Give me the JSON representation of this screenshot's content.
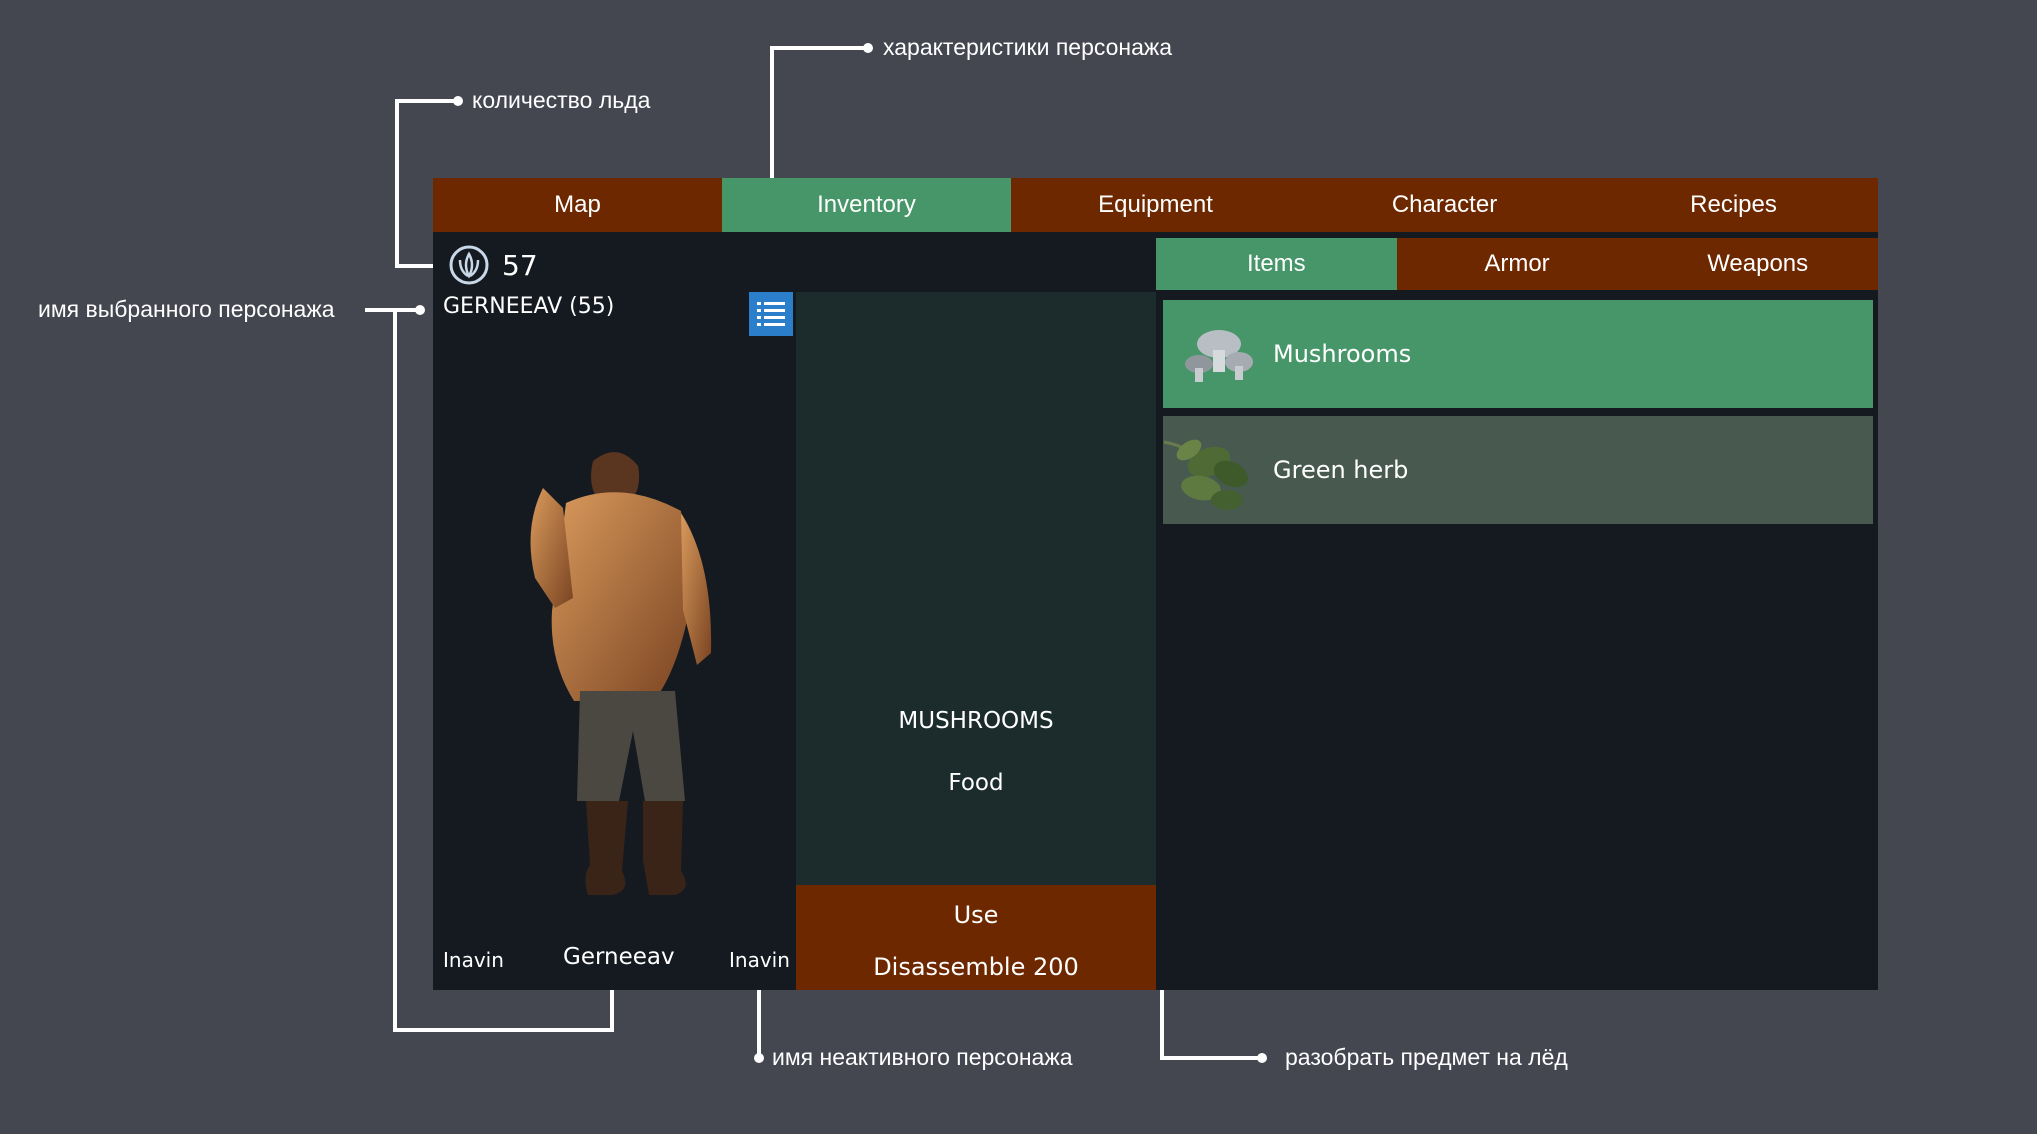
{
  "nav": {
    "tabs": [
      "Map",
      "Inventory",
      "Equipment",
      "Character",
      "Recipes"
    ],
    "active": 1
  },
  "ice": {
    "count": "57"
  },
  "character": {
    "selected_label": "GERNEEAV (55)"
  },
  "characters": {
    "left": "Inavin",
    "center": "Gerneeav",
    "right": "Inavin"
  },
  "subnav": {
    "tabs": [
      "Items",
      "Armor",
      "Weapons"
    ],
    "active": 0
  },
  "detail": {
    "name": "MUSHROOMS",
    "type": "Food"
  },
  "actions": {
    "use": "Use",
    "disassemble": "Disassemble 200"
  },
  "items": [
    {
      "label": "Mushrooms",
      "selected": true
    },
    {
      "label": "Green herb",
      "selected": false
    }
  ],
  "annotations": {
    "stats": "характеристики персонажа",
    "ice": "количество льда",
    "selected_name": "имя выбранного персонажа",
    "inactive_name": "имя неактивного персонажа",
    "disassemble": "разобрать предмет на лёд"
  },
  "colors": {
    "bg": "#444650",
    "panel": "#151a21",
    "tab": "#6e2800",
    "accent": "#469669",
    "detail": "#1c2b2c",
    "item": "#485a4f"
  }
}
